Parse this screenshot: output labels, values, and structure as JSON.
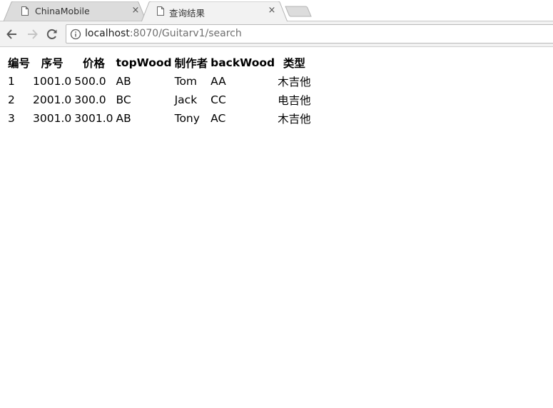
{
  "browser": {
    "tabs": [
      {
        "title": "ChinaMobile",
        "active": false
      },
      {
        "title": "查询结果",
        "active": true
      }
    ],
    "close_glyph": "×",
    "url": {
      "host": "localhost",
      "rest": ":8070/Guitarv1/search"
    }
  },
  "table": {
    "headers": [
      "编号",
      "序号",
      "价格",
      "topWood",
      "制作者",
      "backWood",
      "类型"
    ],
    "rows": [
      [
        "1",
        "1001.0",
        "500.0",
        "AB",
        "Tom",
        "AA",
        "木吉他"
      ],
      [
        "2",
        "2001.0",
        "300.0",
        "BC",
        "Jack",
        "CC",
        "电吉他"
      ],
      [
        "3",
        "3001.0",
        "3001.0",
        "AB",
        "Tony",
        "AC",
        "木吉他"
      ]
    ]
  },
  "colors": {
    "tab_active_bg": "#f2f2f2",
    "tab_inactive_bg": "#dcdcdc",
    "toolbar_bg": "#f2f2f2"
  }
}
